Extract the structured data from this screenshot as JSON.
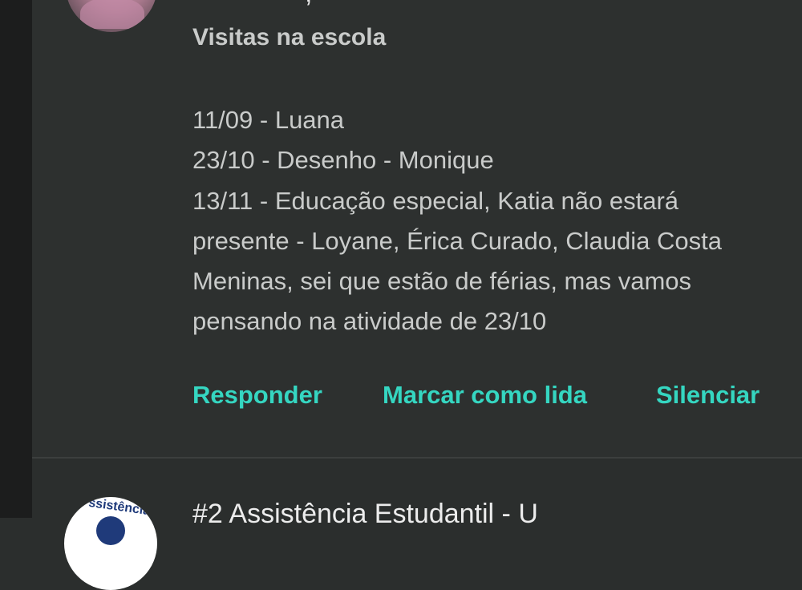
{
  "message": {
    "subject": "Visitas na escola",
    "body_lines": [
      "11/09 - Luana",
      "23/10 - Desenho - Monique",
      "13/11 - Educação especial, Katia não estará",
      "presente - Loyane, Érica Curado, Claudia Costa",
      "Meninas, sei que estão de férias, mas vamos",
      "pensando na atividade de 23/10"
    ],
    "actions": {
      "reply": "Responder",
      "mark_read": "Marcar como lida",
      "mute": "Silenciar"
    },
    "accent_color": "#35d6c1"
  },
  "next_item": {
    "title": "#2 Assistência Estudantil - U",
    "avatar_text": "ssistência"
  }
}
